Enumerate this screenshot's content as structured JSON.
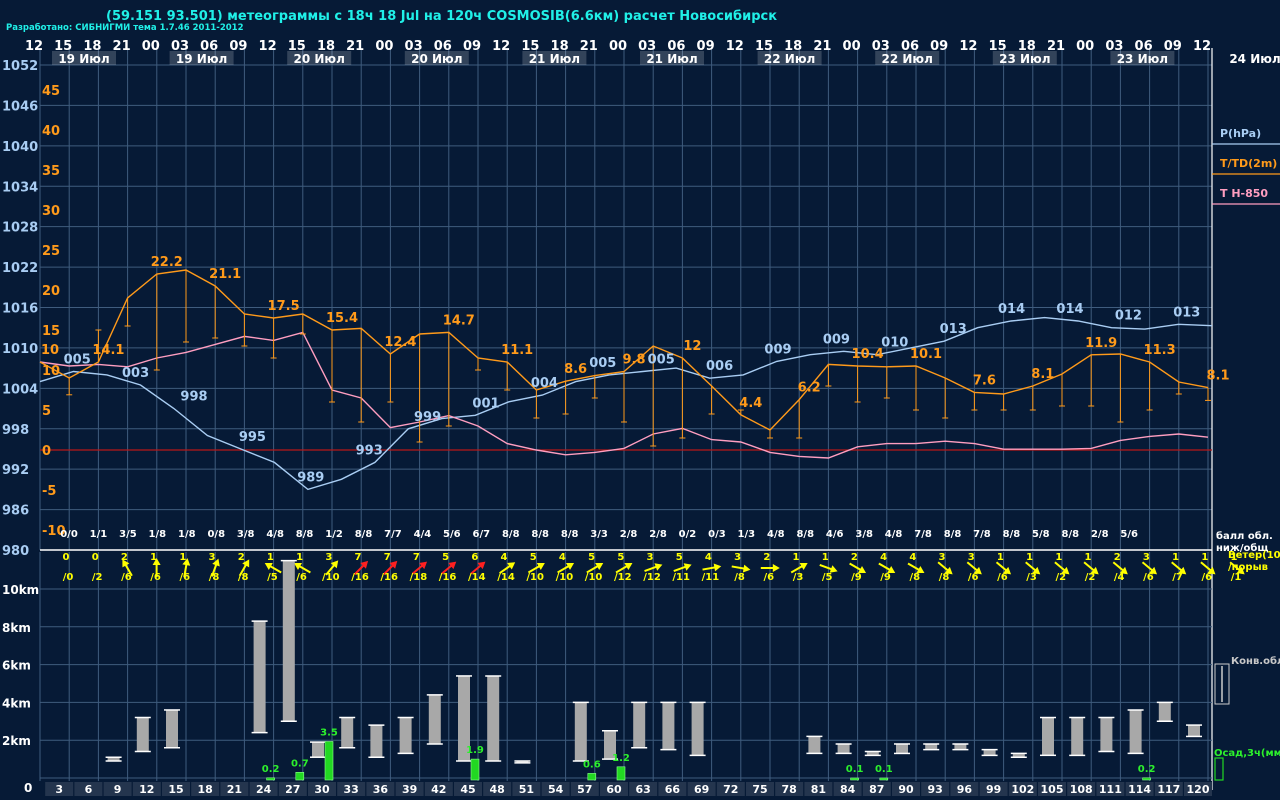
{
  "header": {
    "title": "(59.151 93.501) метеограммы с  18ч 18 Jul на 120ч COSMOSIB(6.6км) расчет Новосибирск",
    "credit": "Разработано: СИБНИГМИ тема 1.7.46 2011-2012"
  },
  "colors": {
    "background": "#061a36",
    "grid": "#3f5c7e",
    "pressure": "#a9cdf3",
    "temperature": "#ff9a1a",
    "t850": "#ff9ec0",
    "zero_line": "#b81818",
    "wind_normal": "#ffff00",
    "wind_strong": "#ff2020",
    "cloud_bar": "#a8a8a8",
    "precip": "#22d822",
    "label_green": "#2cf02c",
    "text": "#ffffff"
  },
  "chart_data": {
    "type": "meteogram",
    "top_hours": [
      "12",
      "15",
      "18",
      "21",
      "00",
      "03",
      "06",
      "09",
      "12",
      "15",
      "18",
      "21",
      "00",
      "03",
      "06",
      "09",
      "12",
      "15",
      "18",
      "21",
      "00",
      "03",
      "06",
      "09",
      "12",
      "15",
      "18",
      "21",
      "00",
      "03",
      "06",
      "09",
      "12",
      "15",
      "18",
      "21",
      "00",
      "03",
      "06",
      "09",
      "12"
    ],
    "date_labels": [
      "19 Июл",
      "19 Июл",
      "20 Июл",
      "20 Июл",
      "21 Июл",
      "21 Июл",
      "22 Июл",
      "22 Июл",
      "23 Июл",
      "23 Июл",
      "24 Июл"
    ],
    "pressure_axis": {
      "label": "P(hPa)",
      "ticks": [
        "1052",
        "1046",
        "1040",
        "1034",
        "1028",
        "1022",
        "1016",
        "1010",
        "1004",
        "998",
        "992",
        "986",
        "980"
      ]
    },
    "temp_axis": {
      "label": "T/TD(2m)",
      "ticks": [
        "45",
        "40",
        "35",
        "30",
        "25",
        "20",
        "15",
        "10",
        "5",
        "0",
        "-5",
        "-10"
      ]
    },
    "t850_label": "T H-850",
    "pressure": [
      1005,
      1006.5,
      1006,
      1004.5,
      1001,
      997,
      995,
      993,
      989,
      990.5,
      993,
      998,
      999.5,
      1000,
      1002,
      1003,
      1005,
      1006,
      1006.5,
      1007,
      1005.5,
      1006,
      1008,
      1009,
      1009.5,
      1009,
      1010,
      1011,
      1013,
      1014,
      1014.5,
      1014,
      1013,
      1012.8,
      1013.5,
      1013.3
    ],
    "pressure_labels": [
      {
        "i": 1,
        "text": "005"
      },
      {
        "i": 3,
        "text": "003"
      },
      {
        "i": 5,
        "text": "998"
      },
      {
        "i": 7,
        "text": "995"
      },
      {
        "i": 9,
        "text": "989"
      },
      {
        "i": 11,
        "text": "993"
      },
      {
        "i": 13,
        "text": "999"
      },
      {
        "i": 15,
        "text": "001"
      },
      {
        "i": 17,
        "text": "004"
      },
      {
        "i": 19,
        "text": "005"
      },
      {
        "i": 21,
        "text": "005"
      },
      {
        "i": 23,
        "text": "006"
      },
      {
        "i": 25,
        "text": "009"
      },
      {
        "i": 27,
        "text": "009"
      },
      {
        "i": 29,
        "text": "010"
      },
      {
        "i": 31,
        "text": "013"
      },
      {
        "i": 33,
        "text": "014"
      },
      {
        "i": 35,
        "text": "014"
      },
      {
        "i": 37,
        "text": "012"
      },
      {
        "i": 39,
        "text": "013"
      }
    ],
    "temperature": [
      11,
      9,
      11,
      19,
      22,
      22.5,
      20.5,
      17,
      16.5,
      17,
      15,
      15.2,
      12,
      14.5,
      14.7,
      11.5,
      11,
      7.5,
      8.6,
      9.3,
      9.8,
      13,
      11.5,
      8,
      4.4,
      2.5,
      6.3,
      10.7,
      10.5,
      10.4,
      10.5,
      9,
      7.2,
      7,
      8,
      9.5,
      11.9,
      12,
      11,
      8.5,
      7.8
    ],
    "dewpoint": [
      null,
      6.9,
      15,
      15.5,
      10,
      13.5,
      14,
      13,
      11.5,
      14.5,
      6,
      3.5,
      6,
      1,
      3,
      10,
      7.5,
      4,
      4.5,
      6.5,
      3.5,
      0.5,
      1.5,
      4.5,
      5,
      1.5,
      1.5,
      8,
      6,
      6.5,
      5,
      4,
      5,
      5,
      5,
      5.5,
      5.5,
      3.5,
      5,
      7,
      6.2
    ],
    "temp_labels": [
      {
        "i": 0,
        "text": "10"
      },
      {
        "i": 2,
        "text": "14.1"
      },
      {
        "i": 4,
        "text": "22.2"
      },
      {
        "i": 6,
        "text": "21.1"
      },
      {
        "i": 8,
        "text": "17.5"
      },
      {
        "i": 10,
        "text": "15.4"
      },
      {
        "i": 12,
        "text": "12.4"
      },
      {
        "i": 14,
        "text": "14.7"
      },
      {
        "i": 16,
        "text": "11.1"
      },
      {
        "i": 18,
        "text": "8.6"
      },
      {
        "i": 20,
        "text": "9.8"
      },
      {
        "i": 22,
        "text": "12"
      },
      {
        "i": 24,
        "text": "4.4"
      },
      {
        "i": 26,
        "text": "6.2"
      },
      {
        "i": 28,
        "text": "10.4"
      },
      {
        "i": 30,
        "text": "10.1"
      },
      {
        "i": 32,
        "text": "7.6"
      },
      {
        "i": 34,
        "text": "8.1"
      },
      {
        "i": 36,
        "text": "11.9"
      },
      {
        "i": 38,
        "text": "11.3"
      },
      {
        "i": 40,
        "text": "8.1"
      }
    ],
    "t850": [
      11,
      10.5,
      10.7,
      10.4,
      11.5,
      12.2,
      13.2,
      14.2,
      13.7,
      14.7,
      7.5,
      6.5,
      2.8,
      3.5,
      4.3,
      3,
      0.8,
      0,
      -0.6,
      -0.3,
      0.2,
      2,
      2.7,
      1.3,
      1,
      -0.3,
      -0.8,
      -1,
      0.4,
      0.8,
      0.8,
      1.1,
      0.8,
      0.1,
      0.1,
      0.1,
      0.2,
      1.2,
      1.7,
      2,
      1.6
    ],
    "cloud_labels": [
      "0/0",
      "1/1",
      "3/5",
      "1/8",
      "1/8",
      "0/8",
      "3/8",
      "4/8",
      "8/8",
      "1/2",
      "8/8",
      "7/7",
      "4/4",
      "5/6",
      "6/7",
      "8/8",
      "8/8",
      "8/8",
      "3/3",
      "2/8",
      "2/8",
      "0/2",
      "0/3",
      "1/3",
      "4/8",
      "8/8",
      "4/6",
      "3/8",
      "4/8",
      "7/8",
      "8/8",
      "7/8",
      "8/8",
      "5/8",
      "8/8",
      "2/8",
      "5/6"
    ],
    "cloud_legend": "балл обл. ниж/общ",
    "wind": [
      {
        "s": "0",
        "g": "/0",
        "d": null
      },
      {
        "s": "0",
        "g": "/2",
        "d": null
      },
      {
        "s": "2",
        "g": "/6",
        "d": 330
      },
      {
        "s": "1",
        "g": "/6",
        "d": 0
      },
      {
        "s": "1",
        "g": "/6",
        "d": 10
      },
      {
        "s": "3",
        "g": "/8",
        "d": 20
      },
      {
        "s": "2",
        "g": "/8",
        "d": 30
      },
      {
        "s": "1",
        "g": "/5",
        "d": 300
      },
      {
        "s": "1",
        "g": "/6",
        "d": 300
      },
      {
        "s": "3",
        "g": "/10",
        "d": 40
      },
      {
        "s": "7",
        "g": "/16",
        "d": 45,
        "strong": true
      },
      {
        "s": "7",
        "g": "/16",
        "d": 45,
        "strong": true
      },
      {
        "s": "7",
        "g": "/18",
        "d": 50,
        "strong": true
      },
      {
        "s": "5",
        "g": "/16",
        "d": 50,
        "strong": true
      },
      {
        "s": "6",
        "g": "/14",
        "d": 50,
        "strong": true
      },
      {
        "s": "4",
        "g": "/14",
        "d": 55
      },
      {
        "s": "5",
        "g": "/10",
        "d": 60
      },
      {
        "s": "4",
        "g": "/10",
        "d": 60
      },
      {
        "s": "5",
        "g": "/10",
        "d": 60
      },
      {
        "s": "5",
        "g": "/12",
        "d": 60
      },
      {
        "s": "3",
        "g": "/12",
        "d": 70
      },
      {
        "s": "5",
        "g": "/11",
        "d": 70
      },
      {
        "s": "4",
        "g": "/11",
        "d": 80
      },
      {
        "s": "3",
        "g": "/8",
        "d": 100
      },
      {
        "s": "2",
        "g": "/6",
        "d": 90
      },
      {
        "s": "1",
        "g": "/3",
        "d": 60
      },
      {
        "s": "1",
        "g": "/5",
        "d": 110
      },
      {
        "s": "2",
        "g": "/9",
        "d": 120
      },
      {
        "s": "4",
        "g": "/9",
        "d": 120
      },
      {
        "s": "4",
        "g": "/8",
        "d": 120
      },
      {
        "s": "3",
        "g": "/8",
        "d": 130
      },
      {
        "s": "3",
        "g": "/6",
        "d": 130
      },
      {
        "s": "1",
        "g": "/6",
        "d": 130
      },
      {
        "s": "1",
        "g": "/3",
        "d": 130
      },
      {
        "s": "1",
        "g": "/2",
        "d": 130
      },
      {
        "s": "1",
        "g": "/2",
        "d": 130
      },
      {
        "s": "2",
        "g": "/4",
        "d": 130
      },
      {
        "s": "3",
        "g": "/6",
        "d": 130
      },
      {
        "s": "1",
        "g": "/7",
        "d": 130
      },
      {
        "s": "1",
        "g": "/6",
        "d": 130
      },
      {
        "s": "1",
        "g": "/1",
        "d": 130
      }
    ],
    "wind_legend": [
      "Ветер(10м)",
      "/порыв"
    ],
    "height_axis": {
      "ticks": [
        "10km",
        "8km",
        "6km",
        "4km",
        "2km",
        "0"
      ]
    },
    "forecast_hours": [
      "3",
      "6",
      "9",
      "12",
      "15",
      "18",
      "21",
      "24",
      "27",
      "30",
      "33",
      "36",
      "39",
      "42",
      "45",
      "48",
      "51",
      "54",
      "57",
      "60",
      "63",
      "66",
      "69",
      "72",
      "75",
      "78",
      "81",
      "84",
      "87",
      "90",
      "93",
      "96",
      "99",
      "102",
      "105",
      "108",
      "111",
      "114",
      "117",
      "120"
    ],
    "conv_clouds": [
      null,
      null,
      [
        0.9,
        1.1
      ],
      [
        1.4,
        3.2
      ],
      [
        1.6,
        3.6
      ],
      null,
      null,
      [
        2.4,
        8.3
      ],
      [
        3.0,
        11.5
      ],
      [
        1.1,
        1.9
      ],
      [
        1.6,
        3.2
      ],
      [
        1.1,
        2.8
      ],
      [
        1.3,
        3.2
      ],
      [
        1.8,
        4.4
      ],
      [
        0.9,
        5.4
      ],
      [
        0.9,
        5.4
      ],
      [
        0.8,
        0.9
      ],
      null,
      [
        0.9,
        4.0
      ],
      [
        1.0,
        2.5
      ],
      [
        1.6,
        4.0
      ],
      [
        1.5,
        4.0
      ],
      [
        1.2,
        4.0
      ],
      null,
      null,
      null,
      [
        1.3,
        2.2
      ],
      [
        1.3,
        1.8
      ],
      [
        1.2,
        1.4
      ],
      [
        1.3,
        1.8
      ],
      [
        1.5,
        1.8
      ],
      [
        1.5,
        1.8
      ],
      [
        1.2,
        1.5
      ],
      [
        1.1,
        1.3
      ],
      [
        1.2,
        3.2
      ],
      [
        1.2,
        3.2
      ],
      [
        1.4,
        3.2
      ],
      [
        1.3,
        3.6
      ],
      [
        3.0,
        4.0
      ],
      [
        2.2,
        2.8
      ]
    ],
    "precip": [
      null,
      null,
      null,
      null,
      null,
      null,
      null,
      0.2,
      0.7,
      3.5,
      null,
      null,
      null,
      null,
      1.9,
      null,
      null,
      null,
      0.6,
      1.2,
      null,
      null,
      null,
      null,
      null,
      null,
      null,
      0.1,
      0.1,
      null,
      null,
      null,
      null,
      null,
      null,
      null,
      null,
      0.2,
      null,
      null
    ],
    "precip_labels": [
      {
        "i": 7,
        "text": "0.2"
      },
      {
        "i": 8,
        "text": "0.7"
      },
      {
        "i": 9,
        "text": "3.5"
      },
      {
        "i": 14,
        "text": "1.9"
      },
      {
        "i": 18,
        "text": "0.6"
      },
      {
        "i": 19,
        "text": "1.2"
      },
      {
        "i": 27,
        "text": "0.1"
      },
      {
        "i": 28,
        "text": "0.1"
      },
      {
        "i": 37,
        "text": "0.2"
      }
    ],
    "conv_legend": "Конв.обл.",
    "precip_legend": "Осад,3ч(мм)"
  }
}
